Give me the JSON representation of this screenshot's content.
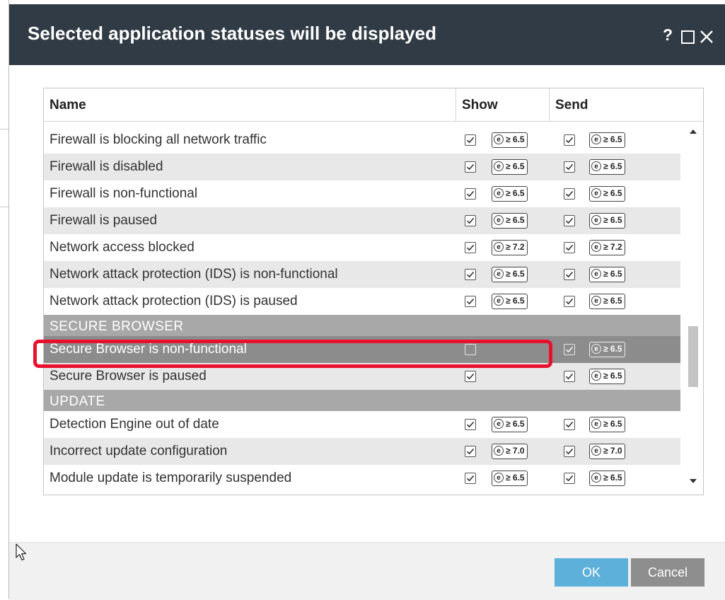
{
  "dialog": {
    "title": "Selected application statuses will be displayed",
    "help_label": "?"
  },
  "columns": {
    "name": "Name",
    "show": "Show",
    "send": "Send"
  },
  "rows": [
    {
      "type": "item",
      "name": "Firewall is blocking all network traffic",
      "show_checked": true,
      "show_version": "≥ 6.5",
      "send_checked": true,
      "send_version": "≥ 6.5"
    },
    {
      "type": "item",
      "name": "Firewall is disabled",
      "show_checked": true,
      "show_version": "≥ 6.5",
      "send_checked": true,
      "send_version": "≥ 6.5"
    },
    {
      "type": "item",
      "name": "Firewall is non-functional",
      "show_checked": true,
      "show_version": "≥ 6.5",
      "send_checked": true,
      "send_version": "≥ 6.5"
    },
    {
      "type": "item",
      "name": "Firewall is paused",
      "show_checked": true,
      "show_version": "≥ 6.5",
      "send_checked": true,
      "send_version": "≥ 6.5"
    },
    {
      "type": "item",
      "name": "Network access blocked",
      "show_checked": true,
      "show_version": "≥ 7.2",
      "send_checked": true,
      "send_version": "≥ 7.2"
    },
    {
      "type": "item",
      "name": "Network attack protection (IDS) is non-functional",
      "show_checked": true,
      "show_version": "≥ 6.5",
      "send_checked": true,
      "send_version": "≥ 6.5"
    },
    {
      "type": "item",
      "name": "Network attack protection (IDS) is paused",
      "show_checked": true,
      "show_version": "≥ 6.5",
      "send_checked": true,
      "send_version": "≥ 6.5"
    },
    {
      "type": "category",
      "name": "SECURE BROWSER"
    },
    {
      "type": "item",
      "name": "Secure Browser is non-functional",
      "show_checked": false,
      "show_version": "",
      "send_checked": true,
      "send_version": "≥ 6.5",
      "selected": true
    },
    {
      "type": "item",
      "name": "Secure Browser is paused",
      "show_checked": true,
      "show_version": "",
      "send_checked": true,
      "send_version": "≥ 6.5"
    },
    {
      "type": "category",
      "name": "UPDATE"
    },
    {
      "type": "item",
      "name": "Detection Engine out of date",
      "show_checked": true,
      "show_version": "≥ 6.5",
      "send_checked": true,
      "send_version": "≥ 6.5"
    },
    {
      "type": "item",
      "name": "Incorrect update configuration",
      "show_checked": true,
      "show_version": "≥ 7.0",
      "send_checked": true,
      "send_version": "≥ 7.0"
    },
    {
      "type": "item",
      "name": "Module update is temporarily suspended",
      "show_checked": true,
      "show_version": "≥ 6.5",
      "send_checked": true,
      "send_version": "≥ 6.5"
    }
  ],
  "version_badge_icon": "e",
  "footer": {
    "ok_label": "OK",
    "cancel_label": "Cancel"
  },
  "colors": {
    "titlebar": "#303b45",
    "row_alt": "#e8e8e8",
    "category": "#a8a8a8",
    "selected_row": "#8c8c8c",
    "highlight": "#e8112d",
    "ok_button": "#5db0d9",
    "cancel_button": "#8e8e8e"
  },
  "icons": {
    "help": "question-mark-icon",
    "maximize": "maximize-icon",
    "close": "close-icon",
    "checkbox": "checkmark-icon",
    "version_badge": "eset-e-icon",
    "scroll_up": "scroll-up-arrow-icon",
    "scroll_down": "scroll-down-arrow-icon",
    "cursor": "mouse-pointer-icon"
  }
}
